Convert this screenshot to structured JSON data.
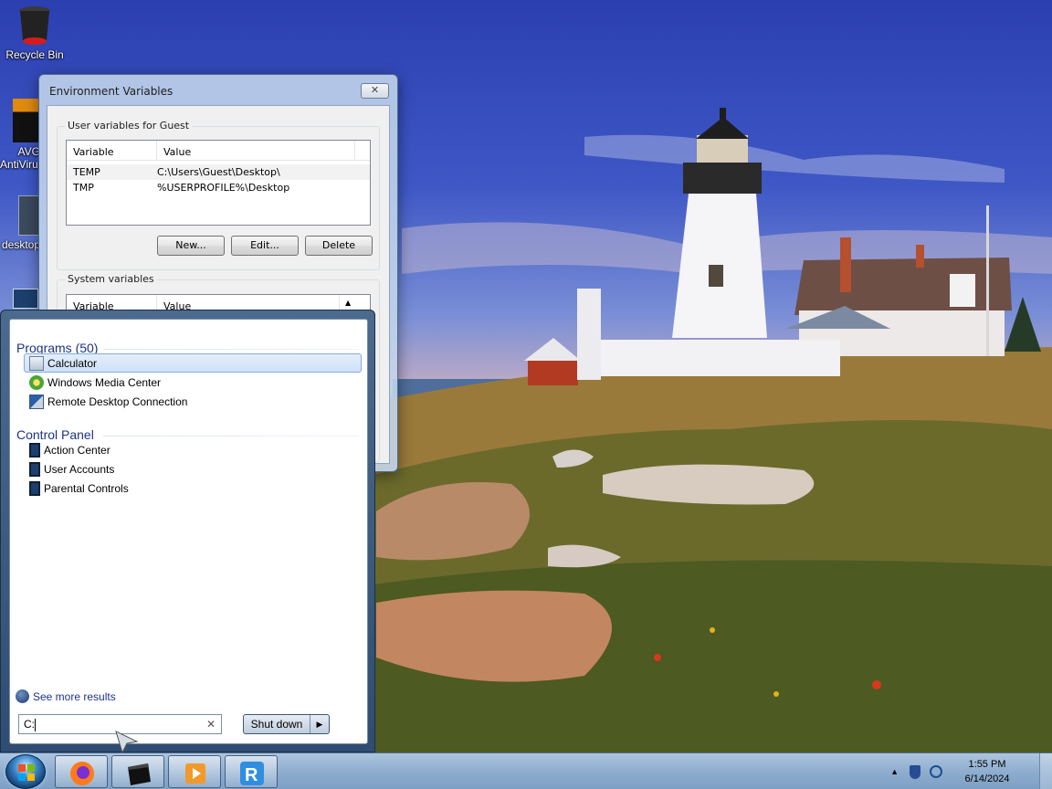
{
  "desktop": {
    "icons": [
      {
        "label": "Recycle Bin",
        "icon": "recycle-bin-icon"
      },
      {
        "label": "AVG AntiVirus",
        "icon": "avg-antivirus-icon"
      },
      {
        "label": "desktop",
        "icon": "desktop-file-icon"
      },
      {
        "label": "",
        "icon": "shortcut-icon"
      }
    ]
  },
  "env_window": {
    "title": "Environment Variables",
    "user_group_title": "User variables for Guest",
    "columns": [
      "Variable",
      "Value"
    ],
    "user_vars": [
      {
        "name": "TEMP",
        "value": "C:\\Users\\Guest\\Desktop\\"
      },
      {
        "name": "TMP",
        "value": "%USERPROFILE%\\Desktop"
      }
    ],
    "buttons": {
      "new": "New...",
      "edit": "Edit...",
      "delete": "Delete"
    },
    "system_group_title": "System variables"
  },
  "start_menu": {
    "programs_header": "Programs (50)",
    "programs": [
      {
        "label": "Calculator",
        "icon": "calculator-icon",
        "selected": true
      },
      {
        "label": "Windows Media Center",
        "icon": "media-center-icon",
        "selected": false
      },
      {
        "label": "Remote Desktop Connection",
        "icon": "remote-desktop-icon",
        "selected": false
      }
    ],
    "control_panel_header": "Control Panel",
    "control_panel": [
      {
        "label": "Action Center",
        "icon": "action-center-icon"
      },
      {
        "label": "User Accounts",
        "icon": "user-accounts-icon"
      },
      {
        "label": "Parental Controls",
        "icon": "parental-controls-icon"
      }
    ],
    "see_more": "See more results",
    "search_value": "C:",
    "shutdown_label": "Shut down"
  },
  "taskbar": {
    "pinned": [
      {
        "name": "firefox",
        "icon": "firefox-icon"
      },
      {
        "name": "terminal",
        "icon": "terminal-icon"
      },
      {
        "name": "media-player",
        "icon": "media-player-icon"
      },
      {
        "name": "vnc",
        "icon": "vnc-icon"
      }
    ],
    "time": "1:55 PM",
    "date": "6/14/2024"
  }
}
